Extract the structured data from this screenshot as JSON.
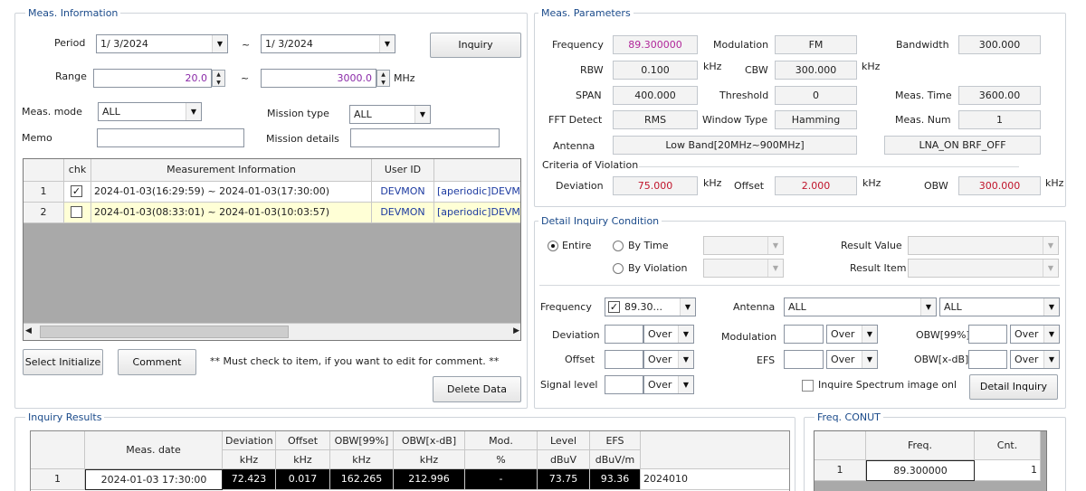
{
  "meas_info": {
    "title": "Meas. Information",
    "period_label": "Period",
    "period_from": "1/ 3/2024",
    "period_to": "1/ 3/2024",
    "tilde": "~",
    "inquiry_label": "Inquiry",
    "range_label": "Range",
    "range_from": "20.0",
    "range_to": "3000.0",
    "range_unit": "MHz",
    "meas_mode_label": "Meas. mode",
    "meas_mode_value": "ALL",
    "mission_type_label": "Mission type",
    "mission_type_value": "ALL",
    "memo_label": "Memo",
    "memo_value": "",
    "mission_details_label": "Mission details",
    "mission_details_value": "",
    "table": {
      "headers": [
        "",
        "chk",
        "Measurement Information",
        "User ID",
        ""
      ],
      "rows": [
        {
          "no": "1",
          "checked": true,
          "info": "2024-01-03(16:29:59) ~ 2024-01-03(17:30:00)",
          "user": "DEVMON",
          "extra": "[aperiodic]DEVM"
        },
        {
          "no": "2",
          "checked": false,
          "info": "2024-01-03(08:33:01) ~ 2024-01-03(10:03:57)",
          "user": "DEVMON",
          "extra": "[aperiodic]DEVM"
        }
      ]
    },
    "select_init_label": "Select Initialize",
    "comment_label": "Comment",
    "comment_note": "** Must check to item, if you want to edit for comment. **",
    "delete_label": "Delete Data"
  },
  "meas_params": {
    "title": "Meas. Parameters",
    "frequency_label": "Frequency",
    "frequency_value": "89.300000",
    "modulation_label": "Modulation",
    "modulation_value": "FM",
    "bandwidth_label": "Bandwidth",
    "bandwidth_value": "300.000",
    "rbw_label": "RBW",
    "rbw_value": "0.100",
    "khz": "kHz",
    "cbw_label": "CBW",
    "cbw_value": "300.000",
    "span_label": "SPAN",
    "span_value": "400.000",
    "threshold_label": "Threshold",
    "threshold_value": "0",
    "meas_time_label": "Meas. Time",
    "meas_time_value": "3600.00",
    "fft_label": "FFT Detect",
    "fft_value": "RMS",
    "window_label": "Window Type",
    "window_value": "Hamming",
    "meas_num_label": "Meas. Num",
    "meas_num_value": "1",
    "antenna_label": "Antenna",
    "antenna_value": "Low Band[20MHz~900MHz]",
    "lna_value": "LNA_ON BRF_OFF",
    "criteria_label": "Criteria of Violation",
    "deviation_label": "Deviation",
    "deviation_value": "75.000",
    "offset_label": "Offset",
    "offset_value": "2.000",
    "obw_label": "OBW",
    "obw_value": "300.000"
  },
  "detail": {
    "title": "Detail Inquiry Condition",
    "entire_label": "Entire",
    "by_time_label": "By Time",
    "by_violation_label": "By Violation",
    "result_value_label": "Result Value",
    "result_item_label": "Result Item",
    "frequency_label": "Frequency",
    "frequency_value": "89.30...",
    "antenna_label": "Antenna",
    "antenna_value": "ALL",
    "antenna_value2": "ALL",
    "deviation_label": "Deviation",
    "offset_label": "Offset",
    "signal_level_label": "Signal level",
    "modulation_label": "Modulation",
    "efs_label": "EFS",
    "obw99_label": "OBW[99%]",
    "obwxdb_label": "OBW[x-dB]",
    "over": "Over",
    "inquire_spectrum_label": "Inquire Spectrum image onl",
    "detail_inquiry_label": "Detail Inquiry"
  },
  "results": {
    "title": "Inquiry Results",
    "headers": [
      "Meas. date",
      "Deviation",
      "Offset",
      "OBW[99%]",
      "OBW[x-dB]",
      "Mod.",
      "Level",
      "EFS"
    ],
    "units": [
      "kHz",
      "kHz",
      "kHz",
      "kHz",
      "%",
      "dBuV",
      "dBuV/m"
    ],
    "rows": [
      {
        "no": "1",
        "date": "2024-01-03 17:30:00",
        "deviation": "72.423",
        "offset": "0.017",
        "obw99": "162.265",
        "obwxdb": "212.996",
        "mod": "-",
        "level": "73.75",
        "efs": "93.36",
        "extra": "2024010"
      }
    ]
  },
  "freq_count": {
    "title": "Freq. CONUT",
    "headers": [
      "Freq.",
      "Cnt."
    ],
    "rows": [
      {
        "no": "1",
        "freq": "89.300000",
        "cnt": "1"
      }
    ]
  },
  "colors": {
    "accent_text": "#1a4a8a",
    "violation_red": "#c0142b",
    "freq_magenta": "#b0279a",
    "selected_row": "#ffffd6"
  }
}
